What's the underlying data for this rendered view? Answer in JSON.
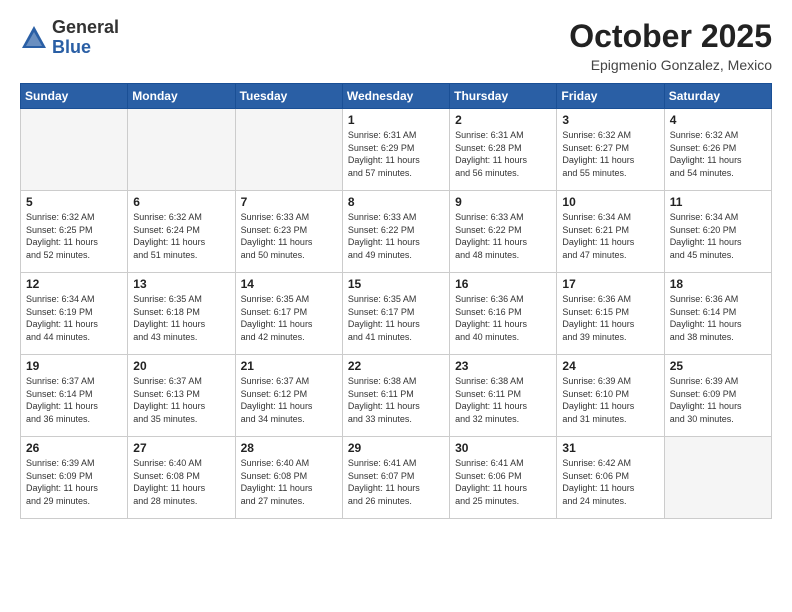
{
  "header": {
    "logo_general": "General",
    "logo_blue": "Blue",
    "month_title": "October 2025",
    "location": "Epigmenio Gonzalez, Mexico"
  },
  "weekdays": [
    "Sunday",
    "Monday",
    "Tuesday",
    "Wednesday",
    "Thursday",
    "Friday",
    "Saturday"
  ],
  "weeks": [
    [
      {
        "day": "",
        "info": ""
      },
      {
        "day": "",
        "info": ""
      },
      {
        "day": "",
        "info": ""
      },
      {
        "day": "1",
        "info": "Sunrise: 6:31 AM\nSunset: 6:29 PM\nDaylight: 11 hours\nand 57 minutes."
      },
      {
        "day": "2",
        "info": "Sunrise: 6:31 AM\nSunset: 6:28 PM\nDaylight: 11 hours\nand 56 minutes."
      },
      {
        "day": "3",
        "info": "Sunrise: 6:32 AM\nSunset: 6:27 PM\nDaylight: 11 hours\nand 55 minutes."
      },
      {
        "day": "4",
        "info": "Sunrise: 6:32 AM\nSunset: 6:26 PM\nDaylight: 11 hours\nand 54 minutes."
      }
    ],
    [
      {
        "day": "5",
        "info": "Sunrise: 6:32 AM\nSunset: 6:25 PM\nDaylight: 11 hours\nand 52 minutes."
      },
      {
        "day": "6",
        "info": "Sunrise: 6:32 AM\nSunset: 6:24 PM\nDaylight: 11 hours\nand 51 minutes."
      },
      {
        "day": "7",
        "info": "Sunrise: 6:33 AM\nSunset: 6:23 PM\nDaylight: 11 hours\nand 50 minutes."
      },
      {
        "day": "8",
        "info": "Sunrise: 6:33 AM\nSunset: 6:22 PM\nDaylight: 11 hours\nand 49 minutes."
      },
      {
        "day": "9",
        "info": "Sunrise: 6:33 AM\nSunset: 6:22 PM\nDaylight: 11 hours\nand 48 minutes."
      },
      {
        "day": "10",
        "info": "Sunrise: 6:34 AM\nSunset: 6:21 PM\nDaylight: 11 hours\nand 47 minutes."
      },
      {
        "day": "11",
        "info": "Sunrise: 6:34 AM\nSunset: 6:20 PM\nDaylight: 11 hours\nand 45 minutes."
      }
    ],
    [
      {
        "day": "12",
        "info": "Sunrise: 6:34 AM\nSunset: 6:19 PM\nDaylight: 11 hours\nand 44 minutes."
      },
      {
        "day": "13",
        "info": "Sunrise: 6:35 AM\nSunset: 6:18 PM\nDaylight: 11 hours\nand 43 minutes."
      },
      {
        "day": "14",
        "info": "Sunrise: 6:35 AM\nSunset: 6:17 PM\nDaylight: 11 hours\nand 42 minutes."
      },
      {
        "day": "15",
        "info": "Sunrise: 6:35 AM\nSunset: 6:17 PM\nDaylight: 11 hours\nand 41 minutes."
      },
      {
        "day": "16",
        "info": "Sunrise: 6:36 AM\nSunset: 6:16 PM\nDaylight: 11 hours\nand 40 minutes."
      },
      {
        "day": "17",
        "info": "Sunrise: 6:36 AM\nSunset: 6:15 PM\nDaylight: 11 hours\nand 39 minutes."
      },
      {
        "day": "18",
        "info": "Sunrise: 6:36 AM\nSunset: 6:14 PM\nDaylight: 11 hours\nand 38 minutes."
      }
    ],
    [
      {
        "day": "19",
        "info": "Sunrise: 6:37 AM\nSunset: 6:14 PM\nDaylight: 11 hours\nand 36 minutes."
      },
      {
        "day": "20",
        "info": "Sunrise: 6:37 AM\nSunset: 6:13 PM\nDaylight: 11 hours\nand 35 minutes."
      },
      {
        "day": "21",
        "info": "Sunrise: 6:37 AM\nSunset: 6:12 PM\nDaylight: 11 hours\nand 34 minutes."
      },
      {
        "day": "22",
        "info": "Sunrise: 6:38 AM\nSunset: 6:11 PM\nDaylight: 11 hours\nand 33 minutes."
      },
      {
        "day": "23",
        "info": "Sunrise: 6:38 AM\nSunset: 6:11 PM\nDaylight: 11 hours\nand 32 minutes."
      },
      {
        "day": "24",
        "info": "Sunrise: 6:39 AM\nSunset: 6:10 PM\nDaylight: 11 hours\nand 31 minutes."
      },
      {
        "day": "25",
        "info": "Sunrise: 6:39 AM\nSunset: 6:09 PM\nDaylight: 11 hours\nand 30 minutes."
      }
    ],
    [
      {
        "day": "26",
        "info": "Sunrise: 6:39 AM\nSunset: 6:09 PM\nDaylight: 11 hours\nand 29 minutes."
      },
      {
        "day": "27",
        "info": "Sunrise: 6:40 AM\nSunset: 6:08 PM\nDaylight: 11 hours\nand 28 minutes."
      },
      {
        "day": "28",
        "info": "Sunrise: 6:40 AM\nSunset: 6:08 PM\nDaylight: 11 hours\nand 27 minutes."
      },
      {
        "day": "29",
        "info": "Sunrise: 6:41 AM\nSunset: 6:07 PM\nDaylight: 11 hours\nand 26 minutes."
      },
      {
        "day": "30",
        "info": "Sunrise: 6:41 AM\nSunset: 6:06 PM\nDaylight: 11 hours\nand 25 minutes."
      },
      {
        "day": "31",
        "info": "Sunrise: 6:42 AM\nSunset: 6:06 PM\nDaylight: 11 hours\nand 24 minutes."
      },
      {
        "day": "",
        "info": ""
      }
    ]
  ]
}
